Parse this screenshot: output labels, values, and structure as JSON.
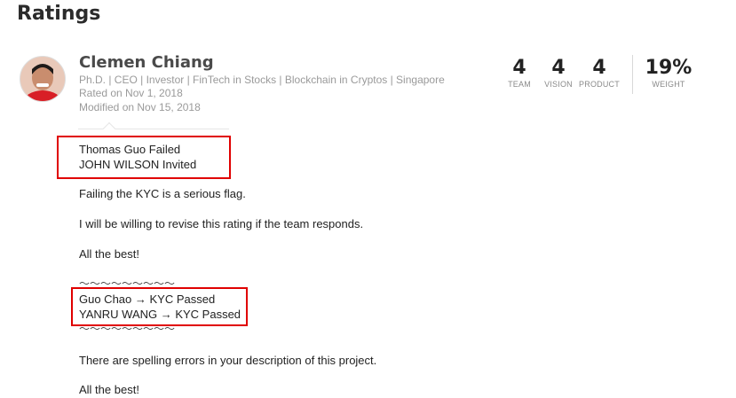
{
  "page": {
    "title": "Ratings"
  },
  "reviewer": {
    "name": "Clemen Chiang",
    "bio": "Ph.D. | CEO | Investor | FinTech in Stocks | Blockchain in Cryptos | Singapore",
    "rated": "Rated on Nov 1, 2018",
    "modified": "Modified on Nov 15, 2018"
  },
  "scores": [
    {
      "value": "4",
      "label": "TEAM"
    },
    {
      "value": "4",
      "label": "VISION"
    },
    {
      "value": "4",
      "label": "PRODUCT"
    },
    {
      "value": "19%",
      "label": "WEIGHT"
    }
  ],
  "review": {
    "line1": "Thomas Guo Failed",
    "line2": "JOHN WILSON Invited",
    "p1": "Failing the KYC is a serious flag.",
    "p2": "I will be willing to revise this rating if the team responds.",
    "p3": "All the best!",
    "tilde1": "〜〜〜〜〜〜〜〜〜",
    "line3": "Guo Chao → KYC Passed",
    "line4": "YANRU WANG → KYC Passed",
    "tilde2": "〜〜〜〜〜〜〜〜〜",
    "p4": "There are spelling errors in your description of this project.",
    "p5": "All the best!"
  },
  "colors": {
    "highlight": "#e00000",
    "muted": "#9a9a9a"
  }
}
